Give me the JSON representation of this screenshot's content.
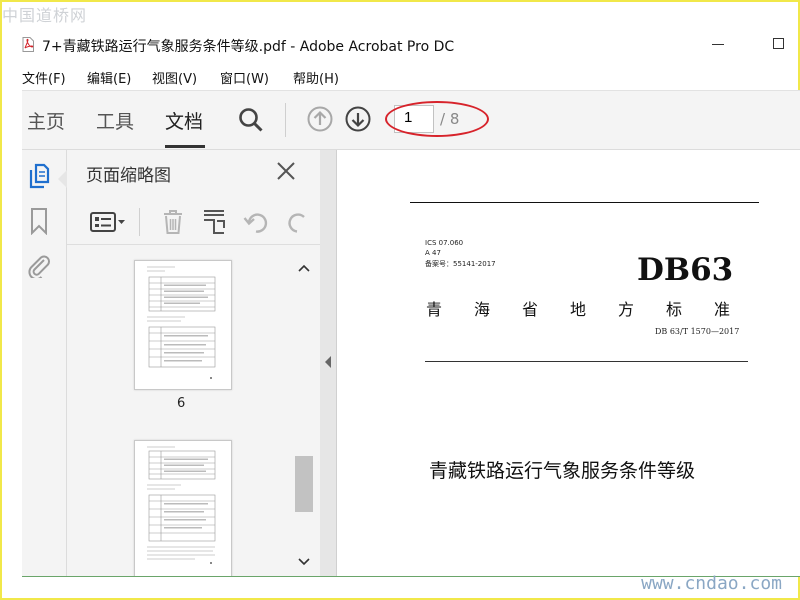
{
  "watermarks": {
    "top_left": "中国道桥网",
    "bottom_right": "www.cndao.com"
  },
  "window": {
    "title": "7+青藏铁路运行气象服务条件等级.pdf - Adobe Acrobat Pro DC",
    "file_icon": "pdf-file-icon"
  },
  "menu": {
    "items": [
      {
        "label": "文件(F)"
      },
      {
        "label": "编辑(E)"
      },
      {
        "label": "视图(V)"
      },
      {
        "label": "窗口(W)"
      },
      {
        "label": "帮助(H)"
      }
    ]
  },
  "toolbar": {
    "tabs": [
      {
        "label": "主页"
      },
      {
        "label": "工具"
      },
      {
        "label": "文档",
        "active": true
      }
    ],
    "icons": [
      "search-icon",
      "page-up-icon",
      "page-down-icon"
    ],
    "current_page": "1",
    "total_pages": "/ 8",
    "highlight_color": "#d7232b"
  },
  "sidebar": {
    "rail_icons": [
      "page-thumbnails-icon",
      "bookmark-icon",
      "attachment-icon"
    ],
    "panel": {
      "title": "页面缩略图",
      "tool_icons": [
        "thumbnail-options-icon",
        "delete-page-icon",
        "extract-page-icon",
        "undo-icon",
        "redo-icon"
      ],
      "thumbnails": [
        {
          "label": "6"
        },
        {
          "label": ""
        }
      ]
    }
  },
  "document": {
    "meta_lines": [
      "ICS 07.060",
      "A 47",
      "备案号：55141-2017"
    ],
    "code": "DB63",
    "standard": "青海省地方标准",
    "number": "DB 63/T 1570—2017",
    "title": "青藏铁路运行气象服务条件等级"
  }
}
